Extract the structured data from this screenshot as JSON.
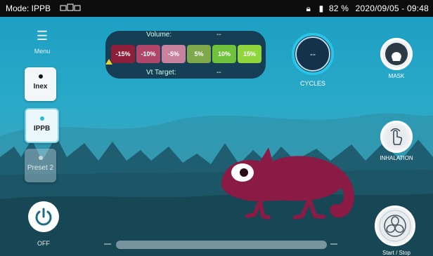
{
  "status_bar": {
    "mode_label": "Mode: IPPB",
    "network_icon": "network-icon",
    "lock_icon": "lock-icon",
    "battery_icon": "battery-icon",
    "battery": "82 %",
    "datetime": "2020/09/05 - 09:48"
  },
  "left_panel": {
    "menu_icon": "hamburger-icon",
    "menu_label": "Menu",
    "modes": [
      {
        "label": "Inex"
      },
      {
        "label": "IPPB"
      },
      {
        "label": "Preset 2"
      }
    ],
    "power_icon": "power-icon",
    "power_label": "OFF"
  },
  "volume_panel": {
    "volume_label": "Volume:",
    "volume_value": "--",
    "vt_label": "Vt Target:",
    "vt_value": "--",
    "chips": [
      {
        "label": "-15%",
        "color": "#8e1f3b"
      },
      {
        "label": "-10%",
        "color": "#b0476b"
      },
      {
        "label": "-5%",
        "color": "#c7829e"
      },
      {
        "label": "5%",
        "color": "#7ea84a"
      },
      {
        "label": "10%",
        "color": "#6fc23b"
      },
      {
        "label": "15%",
        "color": "#8fd63d"
      }
    ]
  },
  "cycles": {
    "value": "--",
    "label": "CYCLES"
  },
  "right_panel": {
    "mask_label": "MASK",
    "mask_icon": "mask-icon",
    "inhalation_label": "INHALATION",
    "inhalation_icon": "hand-pointer-icon",
    "start_label": "Start / Stop",
    "start_icon": "fan-icon"
  },
  "colors": {
    "accent": "#27c6e8",
    "chameleon": "#8a1b45"
  }
}
